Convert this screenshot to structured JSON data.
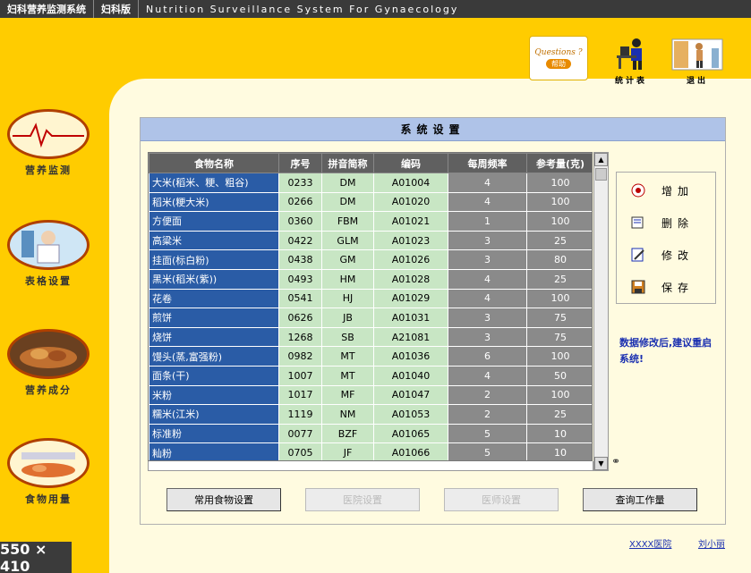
{
  "titlebar": {
    "app_title": "妇科营养监测系统",
    "version": "妇科版",
    "english": "Nutrition Surveillance System For Gynaecology"
  },
  "top_icons": {
    "question_text": "Questions ?",
    "question_badge": "帮助",
    "stats_label": "统计表",
    "exit_label": "退出"
  },
  "sidebar": {
    "items": [
      {
        "label": "营养监测"
      },
      {
        "label": "表格设置"
      },
      {
        "label": "营养成分"
      },
      {
        "label": "食物用量"
      }
    ]
  },
  "settings": {
    "title": "系统设置"
  },
  "table": {
    "columns": [
      "食物名称",
      "序号",
      "拼音简称",
      "编码",
      "每周频率",
      "参考量(克)"
    ],
    "rows": [
      [
        "大米(稻米、粳、粗谷)",
        "0233",
        "DM",
        "A01004",
        "4",
        "100"
      ],
      [
        "稻米(粳大米)",
        "0266",
        "DM",
        "A01020",
        "4",
        "100"
      ],
      [
        "方便面",
        "0360",
        "FBM",
        "A01021",
        "1",
        "100"
      ],
      [
        "高粱米",
        "0422",
        "GLM",
        "A01023",
        "3",
        "25"
      ],
      [
        "挂面(标白粉)",
        "0438",
        "GM",
        "A01026",
        "3",
        "80"
      ],
      [
        "黑米(稻米(紫))",
        "0493",
        "HM",
        "A01028",
        "4",
        "25"
      ],
      [
        "花卷",
        "0541",
        "HJ",
        "A01029",
        "4",
        "100"
      ],
      [
        "煎饼",
        "0626",
        "JB",
        "A01031",
        "3",
        "75"
      ],
      [
        "烧饼",
        "1268",
        "SB",
        "A21081",
        "3",
        "75"
      ],
      [
        "馒头(蒸,富强粉)",
        "0982",
        "MT",
        "A01036",
        "6",
        "100"
      ],
      [
        "面条(干)",
        "1007",
        "MT",
        "A01040",
        "4",
        "50"
      ],
      [
        "米粉",
        "1017",
        "MF",
        "A01047",
        "2",
        "100"
      ],
      [
        "糯米(江米)",
        "1119",
        "NM",
        "A01053",
        "2",
        "25"
      ],
      [
        "标准粉",
        "0077",
        "BZF",
        "A01065",
        "5",
        "10"
      ],
      [
        "籼粉",
        "0705",
        "JF",
        "A01066",
        "5",
        "10"
      ]
    ]
  },
  "actions": {
    "add": "增加",
    "delete": "删除",
    "modify": "修改",
    "save": "保存"
  },
  "note": "数据修改后,建议重启系统!",
  "buttons": {
    "common_food": "常用食物设置",
    "hospital": "医院设置",
    "doctor": "医师设置",
    "workload": "查询工作量"
  },
  "footer": {
    "hospital_link": "XXXX医院",
    "user_link": "刘小丽"
  },
  "size_tag": "550 × 410",
  "colors": {
    "background": "#FFCC00",
    "panel": "#FFFBE0",
    "header_bar": "#AFC3E8",
    "name_cell": "#2A5CA6",
    "code_cell": "#C8E6C4",
    "gray_cell": "#8A8A8A",
    "note_text": "#1a2fb0"
  }
}
